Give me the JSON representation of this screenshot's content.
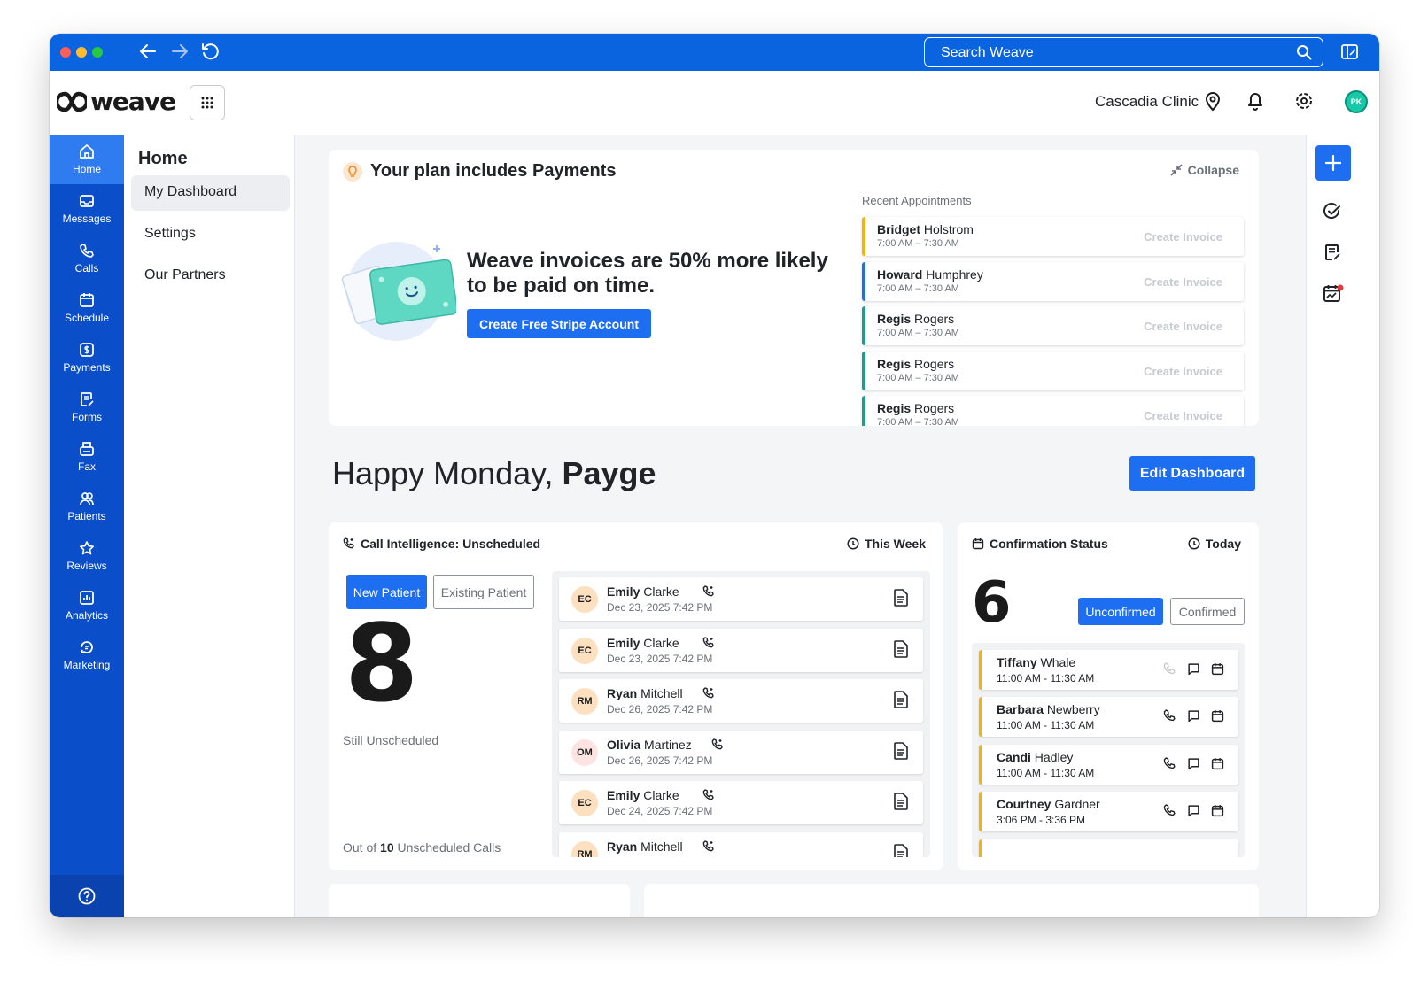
{
  "browser": {
    "search_placeholder": "Search Weave"
  },
  "header": {
    "logo_text": "weave",
    "clinic_name": "Cascadia Clinic",
    "avatar_initials": "PK"
  },
  "sidebar": {
    "items": [
      {
        "label": "Home",
        "icon": "home-icon",
        "active": true
      },
      {
        "label": "Messages",
        "icon": "messages-icon",
        "active": false
      },
      {
        "label": "Calls",
        "icon": "phone-icon",
        "active": false
      },
      {
        "label": "Schedule",
        "icon": "calendar-icon",
        "active": false
      },
      {
        "label": "Payments",
        "icon": "dollar-icon",
        "active": false
      },
      {
        "label": "Forms",
        "icon": "forms-icon",
        "active": false
      },
      {
        "label": "Fax",
        "icon": "fax-icon",
        "active": false
      },
      {
        "label": "Patients",
        "icon": "patients-icon",
        "active": false
      },
      {
        "label": "Reviews",
        "icon": "star-icon",
        "active": false
      },
      {
        "label": "Analytics",
        "icon": "analytics-icon",
        "active": false
      },
      {
        "label": "Marketing",
        "icon": "marketing-icon",
        "active": false
      }
    ],
    "help_icon": "help-icon"
  },
  "subnav": {
    "title": "Home",
    "items": [
      {
        "label": "My Dashboard",
        "active": true
      },
      {
        "label": "Settings",
        "active": false
      },
      {
        "label": "Our Partners",
        "active": false
      }
    ]
  },
  "plan_card": {
    "title": "Your plan includes Payments",
    "collapse_label": "Collapse",
    "promo_text": "Weave invoices are 50% more likely to be paid on time.",
    "cta_label": "Create Free Stripe Account",
    "recent_label": "Recent Appointments",
    "create_invoice_label": "Create Invoice",
    "appointments": [
      {
        "first": "Bridget",
        "last": "Holstrom",
        "time": "7:00 AM – 7:30 AM",
        "color": "#f4b400"
      },
      {
        "first": "Howard",
        "last": "Humphrey",
        "time": "7:00 AM – 7:30 AM",
        "color": "#1e6ef2"
      },
      {
        "first": "Regis",
        "last": "Rogers",
        "time": "7:00 AM – 7:30 AM",
        "color": "#1a9e8e"
      },
      {
        "first": "Regis",
        "last": "Rogers",
        "time": "7:00 AM – 7:30 AM",
        "color": "#1a9e8e"
      },
      {
        "first": "Regis",
        "last": "Rogers",
        "time": "7:00 AM – 7:30 AM",
        "color": "#1a9e8e"
      }
    ]
  },
  "greeting": {
    "prefix": "Happy Monday,",
    "name": "Payge",
    "edit_label": "Edit Dashboard"
  },
  "call_intel": {
    "title": "Call Intelligence: Unscheduled",
    "period": "This Week",
    "tab_new": "New Patient",
    "tab_existing": "Existing Patient",
    "count": "8",
    "still_label": "Still Unscheduled",
    "out_of_prefix": "Out of",
    "out_of_count": "10",
    "out_of_suffix": "Unscheduled Calls",
    "calls": [
      {
        "initials": "EC",
        "first": "Emily",
        "last": "Clarke",
        "date": "Dec 23, 2025 7:42 PM",
        "avatar_color": "#fde0bf"
      },
      {
        "initials": "EC",
        "first": "Emily",
        "last": "Clarke",
        "date": "Dec 23, 2025 7:42 PM",
        "avatar_color": "#fde0bf"
      },
      {
        "initials": "RM",
        "first": "Ryan",
        "last": "Mitchell",
        "date": "Dec 26, 2025 7:42 PM",
        "avatar_color": "#fde0bf"
      },
      {
        "initials": "OM",
        "first": "Olivia",
        "last": "Martinez",
        "date": "Dec 26, 2025 7:42 PM",
        "avatar_color": "#fde4e2"
      },
      {
        "initials": "EC",
        "first": "Emily",
        "last": "Clarke",
        "date": "Dec 24, 2025 7:42 PM",
        "avatar_color": "#fde0bf"
      },
      {
        "initials": "RM",
        "first": "Ryan",
        "last": "Mitchell",
        "date": "",
        "avatar_color": "#fde0bf"
      }
    ]
  },
  "confirmation": {
    "title": "Confirmation Status",
    "period": "Today",
    "count": "6",
    "tab_unconfirmed": "Unconfirmed",
    "tab_confirmed": "Confirmed",
    "rows": [
      {
        "first": "Tiffany",
        "last": "Whale",
        "time": "11:00 AM - 11:30 AM",
        "phone_disabled": true
      },
      {
        "first": "Barbara",
        "last": "Newberry",
        "time": "11:00 AM - 11:30 AM",
        "phone_disabled": false
      },
      {
        "first": "Candi",
        "last": "Hadley",
        "time": "11:00 AM - 11:30 AM",
        "phone_disabled": false
      },
      {
        "first": "Courtney",
        "last": "Gardner",
        "time": "3:06 PM - 3:36 PM",
        "phone_disabled": false
      }
    ]
  },
  "colors": {
    "brand_blue": "#0a63df",
    "sidebar_blue": "#0a4ec9",
    "primary": "#1e6ef2",
    "pending_yellow": "#f4b400"
  }
}
